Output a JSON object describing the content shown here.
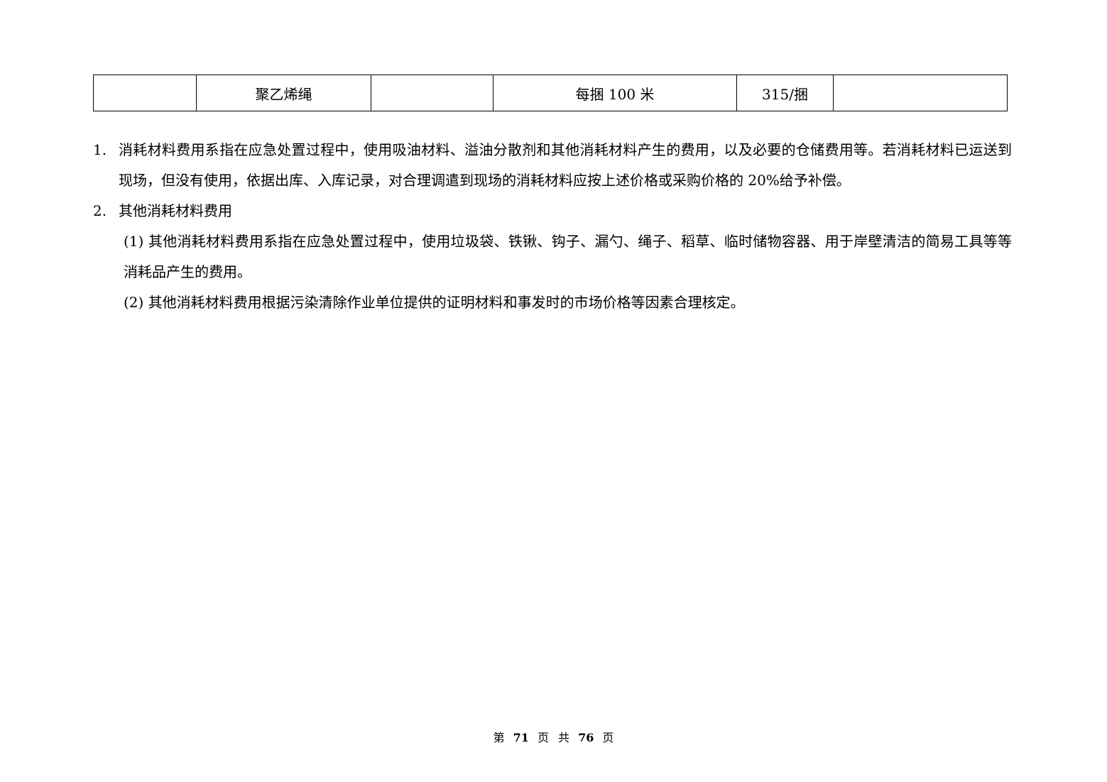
{
  "table": {
    "row": [
      "",
      "聚乙烯绳",
      "",
      "每捆 100 米",
      "315/捆",
      ""
    ]
  },
  "notes": {
    "item1": {
      "num": "1.",
      "text": "消耗材料费用系指在应急处置过程中，使用吸油材料、溢油分散剂和其他消耗材料产生的费用，以及必要的仓储费用等。若消耗材料已运送到现场，但没有使用，依据出库、入库记录，对合理调遣到现场的消耗材料应按上述价格或采购价格的 20%给予补偿。"
    },
    "item2": {
      "num": "2.",
      "text": "其他消耗材料费用"
    },
    "sub1": "(1) 其他消耗材料费用系指在应急处置过程中，使用垃圾袋、铁锹、钩子、漏勺、绳子、稻草、临时储物容器、用于岸壁清洁的简易工具等等消耗品产生的费用。",
    "sub2": "(2) 其他消耗材料费用根据污染清除作业单位提供的证明材料和事发时的市场价格等因素合理核定。"
  },
  "footer": {
    "prefix": "第",
    "page": "71",
    "mid1": "页",
    "mid2": "共",
    "total": "76",
    "suffix": "页"
  }
}
